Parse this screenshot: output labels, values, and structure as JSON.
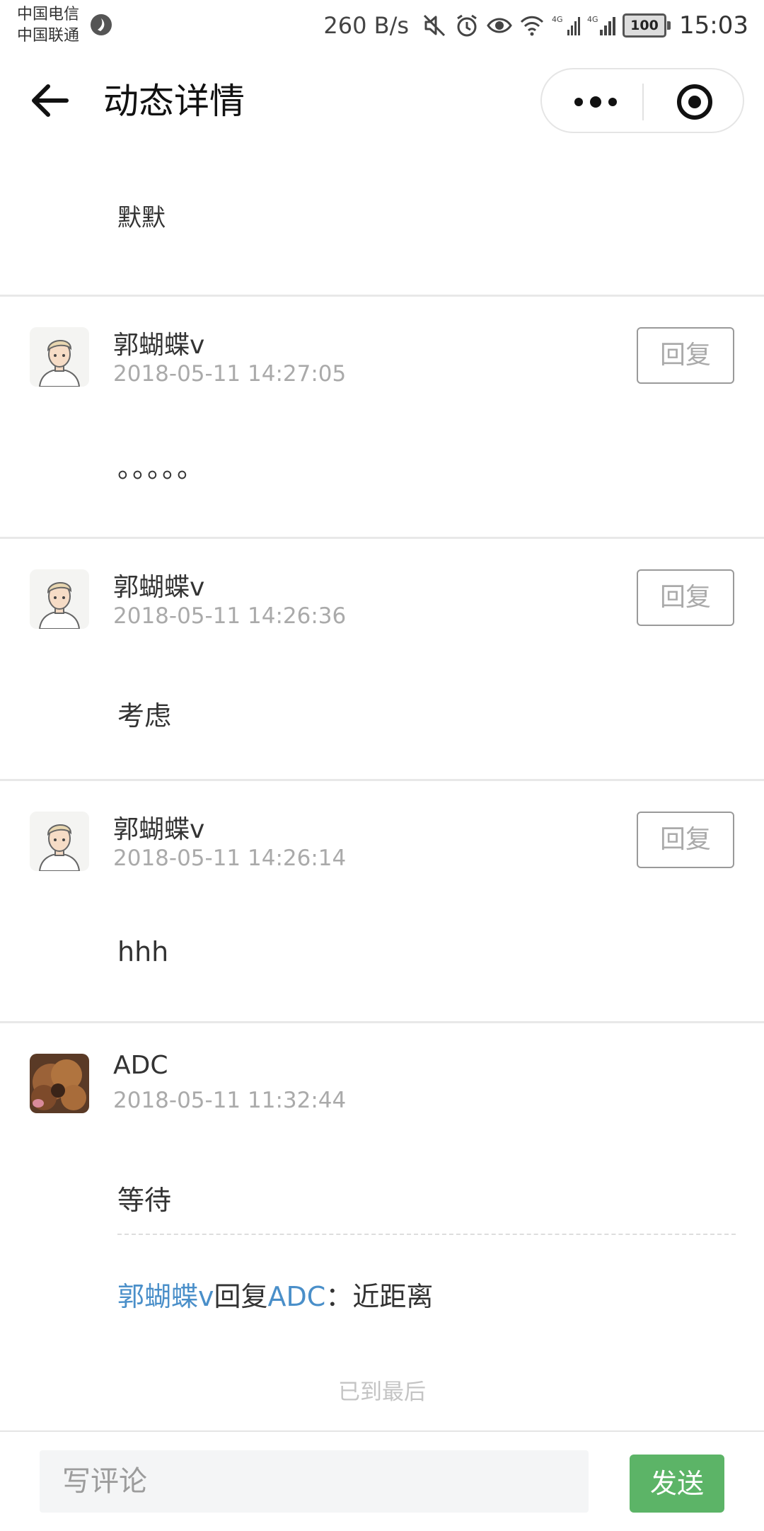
{
  "status_bar": {
    "carrier1": "中国电信",
    "carrier2": "中国联通",
    "speed": "260 B/s",
    "network1": "4G",
    "network2": "4G",
    "battery": "100",
    "time": "15:03"
  },
  "nav": {
    "title": "动态详情",
    "back_icon": "arrow-left-icon",
    "more_icon": "more-dots-icon",
    "close_icon": "target-circle-icon"
  },
  "post": {
    "text": "默默"
  },
  "comments": [
    {
      "name": "郭蝴蝶v",
      "time": "2018-05-11 14:27:05",
      "text": "。。。。。",
      "reply_label": "回复",
      "avatar": "cartoon-man-avatar"
    },
    {
      "name": "郭蝴蝶v",
      "time": "2018-05-11 14:26:36",
      "text": "考虑",
      "reply_label": "回复",
      "avatar": "cartoon-man-avatar"
    },
    {
      "name": "郭蝴蝶v",
      "time": "2018-05-11 14:26:14",
      "text": "hhh",
      "reply_label": "回复",
      "avatar": "cartoon-man-avatar"
    },
    {
      "name": "ADC",
      "time": "2018-05-11 11:32:44",
      "text": "等待",
      "avatar": "dog-photo-avatar",
      "sub_reply": {
        "from": "郭蝴蝶v",
        "verb": "回复",
        "to": "ADC",
        "colon": "：",
        "text": "近距离"
      }
    }
  ],
  "end_text": "已到最后",
  "composer": {
    "placeholder": "写评论",
    "send_label": "发送"
  },
  "colors": {
    "link": "#4a8fc9",
    "send_button": "#5cb467"
  }
}
